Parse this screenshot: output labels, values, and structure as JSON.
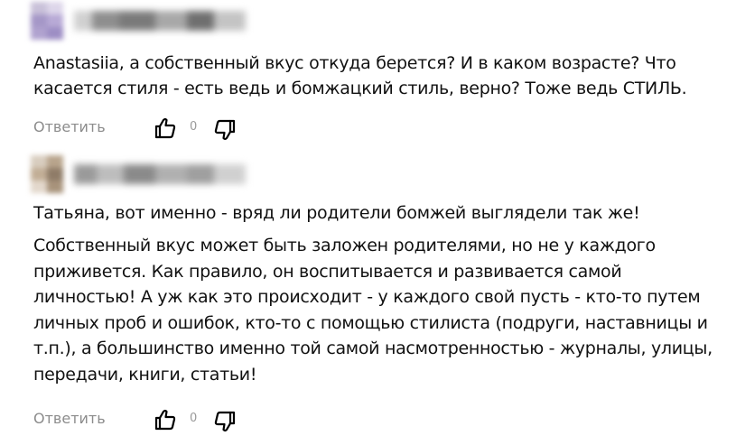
{
  "comments": [
    {
      "text": "Anastasiia, а собственный вкус откуда берется? И в каком возрасте? Что касается стиля - есть ведь и бомжацкий стиль, верно? Тоже ведь СТИЛЬ.",
      "reply_label": "Ответить",
      "like_count": "0"
    },
    {
      "paragraphs": [
        "Татьяна, вот именно - вряд ли родители бомжей выглядели так же!",
        "Собственный вкус может быть заложен родителями, но не у каждого приживется. Как правило, он воспитывается и развивается самой личностью! А уж как это происходит - у каждого свой пусть - кто-то путем личных проб и ошибок, кто-то с помощью стилиста (подруги, наставницы и т.п.), а большинство именно той самой насмотренностью - журналы, улицы, передачи, книги, статьи!"
      ],
      "reply_label": "Ответить",
      "like_count": "0"
    }
  ],
  "icons": {
    "like": "thumbs-up-icon",
    "dislike": "thumbs-down-icon"
  },
  "colors": {
    "text": "#111111",
    "muted": "#8c8c8c",
    "icon": "#000000"
  }
}
